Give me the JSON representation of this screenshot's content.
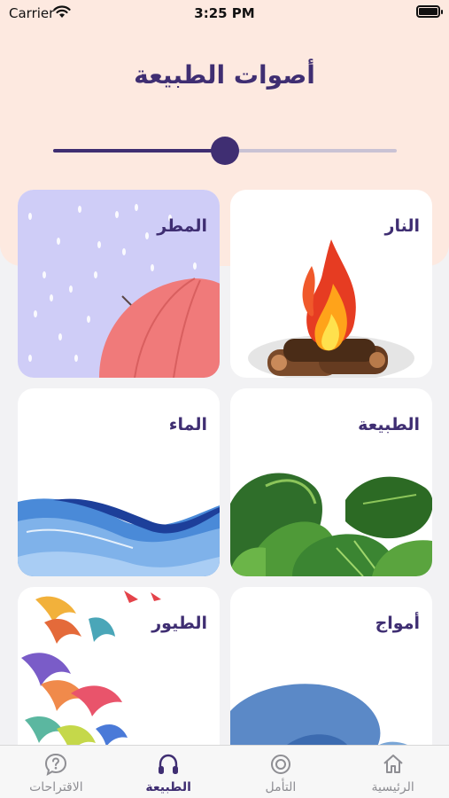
{
  "status_bar": {
    "carrier": "Carrier",
    "time": "3:25 PM"
  },
  "header": {
    "title": "أصوات الطبيعة"
  },
  "volume": {
    "level": 0.5
  },
  "cards": [
    {
      "label": "النار",
      "icon": "fire-icon"
    },
    {
      "label": "المطر",
      "icon": "umbrella-icon"
    },
    {
      "label": "الطبيعة",
      "icon": "leaves-icon"
    },
    {
      "label": "الماء",
      "icon": "water-icon"
    },
    {
      "label": "أمواج",
      "icon": "wave-icon"
    },
    {
      "label": "الطيور",
      "icon": "birds-icon"
    }
  ],
  "tabs": [
    {
      "label": "الرئيسية",
      "icon": "home-icon",
      "active": false
    },
    {
      "label": "التأمل",
      "icon": "meditation-icon",
      "active": false
    },
    {
      "label": "الطبيعة",
      "icon": "headphones-icon",
      "active": true
    },
    {
      "label": "الاقتراحات",
      "icon": "question-icon",
      "active": false
    }
  ],
  "colors": {
    "primary": "#3f2e72",
    "header_bg": "#fde9e0",
    "page_bg": "#f2f2f4",
    "inactive": "#8e8e93"
  }
}
